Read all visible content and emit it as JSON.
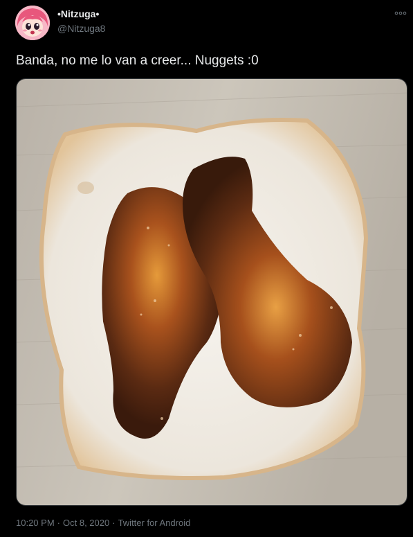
{
  "author": {
    "display_name": "•Nitzuga•",
    "handle": "@Nitzuga8",
    "avatar_icon": "anime-avatar-icon"
  },
  "tweet": {
    "text": "Banda, no me lo van a creer... Nuggets :0"
  },
  "media": {
    "icon": "photo-nuggets-on-bread"
  },
  "meta": {
    "time": "10:20 PM",
    "date": "Oct 8, 2020",
    "source": "Twitter for Android",
    "separator": "·"
  },
  "colors": {
    "background": "#000000",
    "primary_text": "#e7e9ea",
    "secondary_text": "#6e767d",
    "border": "#2f3336"
  }
}
